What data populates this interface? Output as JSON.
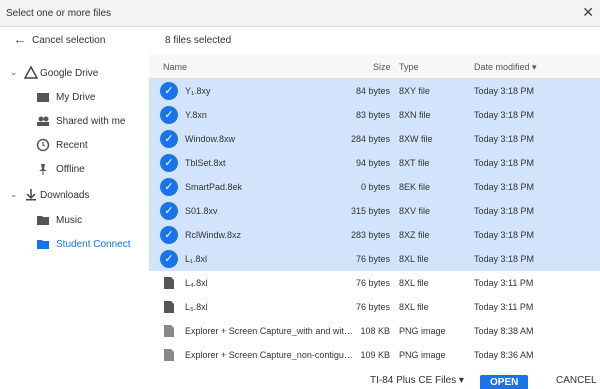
{
  "window": {
    "title": "Select one or more files",
    "close_icon": "close-icon"
  },
  "nav": {
    "back_label": "Cancel selection",
    "items": [
      {
        "label": "Google Drive",
        "icon": "drive-icon",
        "expanded": true
      },
      {
        "label": "My Drive",
        "icon": "folder-drive-icon"
      },
      {
        "label": "Shared with me",
        "icon": "people-icon"
      },
      {
        "label": "Recent",
        "icon": "clock-icon"
      },
      {
        "label": "Offline",
        "icon": "pin-icon"
      },
      {
        "label": "Downloads",
        "icon": "download-icon",
        "expanded": true
      },
      {
        "label": "Music",
        "icon": "folder-icon"
      },
      {
        "label": "Student Connect",
        "icon": "folder-icon",
        "selected": true
      }
    ]
  },
  "header": {
    "count_label": "8 files selected"
  },
  "table": {
    "columns": [
      "Name",
      "Size",
      "Type",
      "Date modified"
    ],
    "rows": [
      {
        "name": "Y₁.8xy",
        "size": "84 bytes",
        "type": "8XY file",
        "date": "Today 3:18 PM",
        "selected": true
      },
      {
        "name": "Y.8xn",
        "size": "83 bytes",
        "type": "8XN file",
        "date": "Today 3:18 PM",
        "selected": true
      },
      {
        "name": "Window.8xw",
        "size": "284 bytes",
        "type": "8XW file",
        "date": "Today 3:18 PM",
        "selected": true
      },
      {
        "name": "TblSet.8xt",
        "size": "94 bytes",
        "type": "8XT file",
        "date": "Today 3:18 PM",
        "selected": true
      },
      {
        "name": "SmartPad.8ek",
        "size": "0 bytes",
        "type": "8EK file",
        "date": "Today 3:18 PM",
        "selected": true
      },
      {
        "name": "S01.8xv",
        "size": "315 bytes",
        "type": "8XV file",
        "date": "Today 3:18 PM",
        "selected": true
      },
      {
        "name": "RclWindw.8xz",
        "size": "283 bytes",
        "type": "8XZ file",
        "date": "Today 3:18 PM",
        "selected": true
      },
      {
        "name": "L₁.8xl",
        "size": "76 bytes",
        "type": "8XL file",
        "date": "Today 3:18 PM",
        "selected": true
      },
      {
        "name": "L₄.8xl",
        "size": "76 bytes",
        "type": "8XL file",
        "date": "Today 3:11 PM",
        "selected": false
      },
      {
        "name": "L₅.8xl",
        "size": "76 bytes",
        "type": "8XL file",
        "date": "Today 3:11 PM",
        "selected": false
      },
      {
        "name": "Explorer + Screen Capture_with and with...",
        "size": "108 KB",
        "type": "PNG image",
        "date": "Today 8:38 AM",
        "selected": false
      },
      {
        "name": "Explorer + Screen Capture_non-contiguo...",
        "size": "109 KB",
        "type": "PNG image",
        "date": "Today 8:36 AM",
        "selected": false
      }
    ]
  },
  "footer": {
    "filetype": "TI-84 Plus CE Files",
    "open_label": "OPEN",
    "cancel_label": "CANCEL"
  }
}
